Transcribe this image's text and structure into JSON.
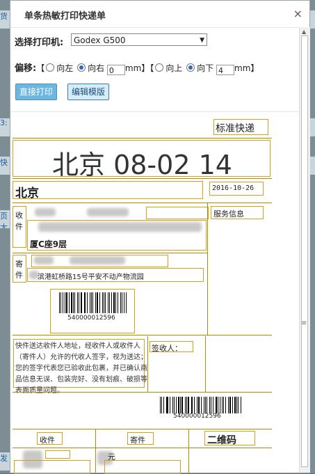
{
  "background": {
    "left_texts": [
      "货",
      "3:",
      "快",
      "页大",
      "",
      "发"
    ]
  },
  "dialog": {
    "title": "单条热敏打印快递单",
    "close_label": "×"
  },
  "printer": {
    "label": "选择打印机:",
    "selected": "Godex G500"
  },
  "offset": {
    "label": "偏移:",
    "bracket_open": "【",
    "bracket_close": "】",
    "left_label": "向左",
    "right_label": "向右",
    "horizontal_value": "0",
    "horizontal_unit": "mm",
    "up_label": "向上",
    "down_label": "向下",
    "vertical_value": "4",
    "vertical_unit": "mm"
  },
  "buttons": {
    "print": "直接打印",
    "edit_template": "编辑模版"
  },
  "label": {
    "service_type": "标准快递",
    "route_code": "北京 08-02 14",
    "city": "北京",
    "date": "2016-10-26",
    "recipient_tag": "收件",
    "service_info": "服务信息",
    "recipient_addr_tail": "厦C座9层",
    "sender_tag": "寄件",
    "sender_addr": "滨港虹桥路15号平安不动产物流园",
    "tracking_number_top": "540000012596",
    "notice": "快件送达收件人地址，经收件人或收件人（寄件人）允许的代收人签字，视为送达；您的签字代表您已验收此包裹，并已确认商品信息无误、包装完好、没有划痕、破损等表面质量问题。",
    "signature_label": "签收人：",
    "tracking_number_bottom": "540000012596",
    "bottom_recipient": "收件",
    "bottom_sender": "寄件",
    "qr_label": "二维码",
    "bottom_sender_frag": "元"
  }
}
